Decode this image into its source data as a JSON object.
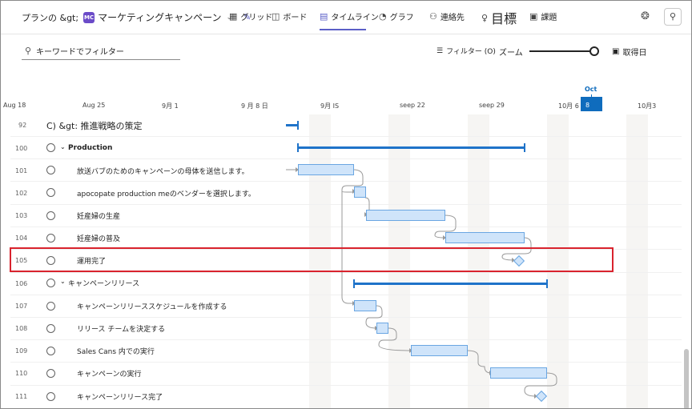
{
  "topbar": {
    "breadcrumb_prefix": "プランの &gt;",
    "plan_badge": "MC",
    "plan_name": "マーケティングキャンペーン",
    "tabs": [
      {
        "label": "グリッド",
        "icon": "grid-icon"
      },
      {
        "label": "ボード",
        "icon": "board-icon"
      },
      {
        "label": "タイムライン",
        "icon": "timeline-icon",
        "active": true
      },
      {
        "label": "グラフ",
        "icon": "chart-icon"
      },
      {
        "label": "連絡先",
        "icon": "people-icon"
      },
      {
        "label": "目標",
        "icon": "goal-icon"
      },
      {
        "label": "課題",
        "icon": "issues-icon"
      }
    ]
  },
  "toolbar": {
    "search_placeholder": "キーワードでフィルター",
    "filter_label": "フィルター (O)",
    "zoom_label": "ズーム",
    "zoom_level": 1.0,
    "today_label": "取得日"
  },
  "timeline": {
    "month_label": "Oct",
    "dates": [
      "Aug 18",
      "Aug 25",
      "9月 1",
      "9 月 8 日",
      "9月 IS",
      "seep 22",
      "seep 29",
      "10月 6 日",
      "10月3"
    ],
    "today_marker": "8"
  },
  "rows": [
    {
      "num": "92",
      "name": "C) &gt: 推進戦略の策定"
    },
    {
      "num": "100",
      "name": "Production"
    },
    {
      "num": "101",
      "name": "放送バブのためのキャンペーンの母体を送信します。"
    },
    {
      "num": "102",
      "name": "apocopate production meのベンダーを選択します。"
    },
    {
      "num": "103",
      "name": "妊産婦の生産"
    },
    {
      "num": "104",
      "name": "妊産婦の普及"
    },
    {
      "num": "105",
      "name": "運用完了"
    },
    {
      "num": "106",
      "name": "キャンペーンリリース"
    },
    {
      "num": "107",
      "name": "キャンペーンリリーススケジュールを作成する"
    },
    {
      "num": "108",
      "name": "リリース チームを決定する"
    },
    {
      "num": "109",
      "name": "Sales Cans 内での実行"
    },
    {
      "num": "110",
      "name": "キャンペーンの実行"
    },
    {
      "num": "111",
      "name": "キャンペーンリリース完了"
    }
  ],
  "colors": {
    "accent": "#5b5fc7",
    "today": "#0f6cbd",
    "bar_fill": "#cfe4fa",
    "summary_bar": "#1f73c9",
    "highlight": "#d9232e"
  }
}
